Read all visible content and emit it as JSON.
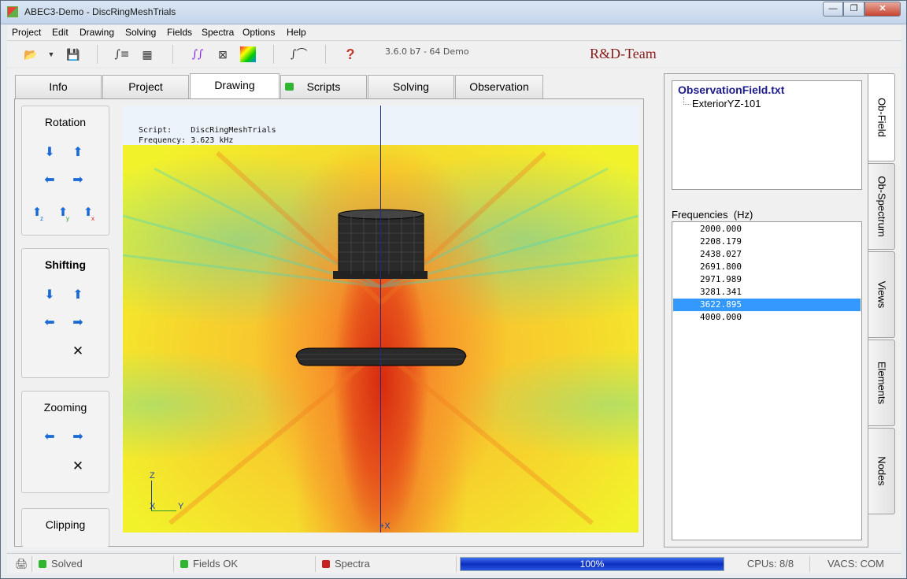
{
  "window": {
    "title": "ABEC3-Demo - DiscRingMeshTrials",
    "min": "—",
    "max": "❐",
    "close": "✕"
  },
  "menu": [
    "Project",
    "Edit",
    "Drawing",
    "Solving",
    "Fields",
    "Spectra",
    "Options",
    "Help"
  ],
  "toolbar": {
    "version": "3.6.0 b7 - 64 Demo",
    "team": "R&D-Team",
    "help_icon": "?"
  },
  "tabs": [
    "Info",
    "Project",
    "Drawing",
    "Scripts",
    "Solving",
    "Observation"
  ],
  "active_tab": "Drawing",
  "groups": {
    "rotation": "Rotation",
    "shifting": "Shifting",
    "zooming": "Zooming",
    "clipping": "Clipping"
  },
  "canvas": {
    "script_line": "Script:    DiscRingMeshTrials",
    "frequency_line": "Frequency: 3.623 kHz",
    "axis_z": "Z",
    "axis_y": "Y",
    "axis_x": "X",
    "bottom_marker": "+X"
  },
  "observation": {
    "file": "ObservationField.txt",
    "child": "ExteriorYZ-101"
  },
  "frequencies": {
    "label": "Frequencies  (Hz)",
    "values": [
      "2000.000",
      "2208.179",
      "2438.027",
      "2691.800",
      "2971.989",
      "3281.341",
      "3622.895",
      "4000.000"
    ],
    "selected": "3622.895"
  },
  "side_tabs": [
    "Ob-Field",
    "Ob-Spectrum",
    "Views",
    "Elements",
    "Nodes"
  ],
  "status": {
    "solved": "Solved",
    "fields": "Fields OK",
    "spectra": "Spectra",
    "progress_percent": 100,
    "progress_text": "100%",
    "cpus": "CPUs: 8/8",
    "vacs": "VACS: COM"
  },
  "colors": {
    "ok": "#2fb52f",
    "error": "#c62020",
    "selection": "#3399ff",
    "progress": "#1a3fd4"
  }
}
